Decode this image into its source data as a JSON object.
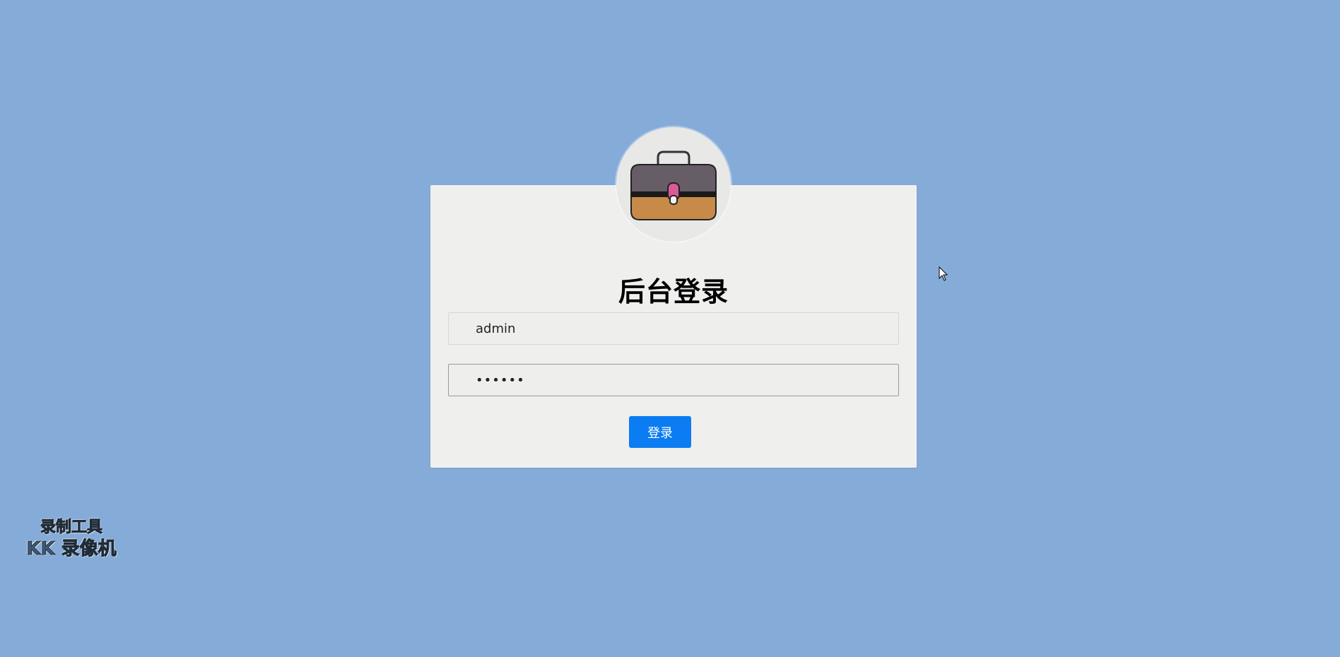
{
  "login": {
    "title": "后台登录",
    "username": {
      "value": "admin"
    },
    "password": {
      "value": "••••••"
    },
    "submit_label": "登录"
  },
  "avatar": {
    "icon": "briefcase-icon"
  },
  "watermark": {
    "line1": "录制工具",
    "line2": "KK 录像机"
  },
  "colors": {
    "background": "#85acd9",
    "card": "#eff0ee",
    "button": "#0b7cf2"
  }
}
